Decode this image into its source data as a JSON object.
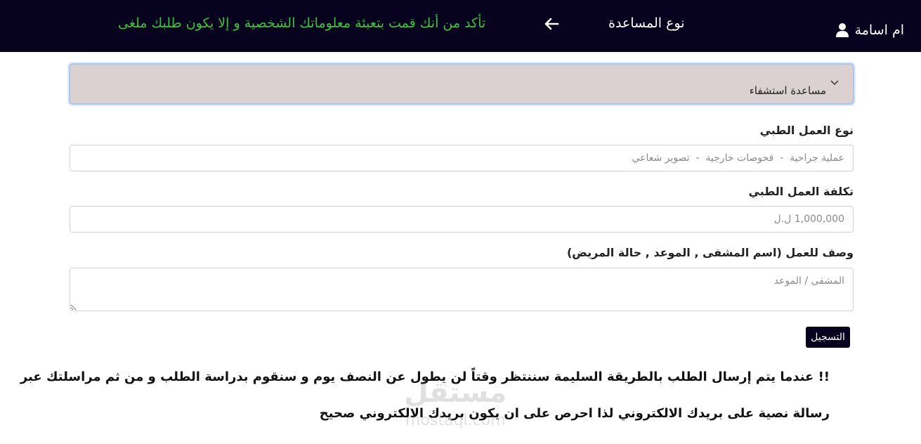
{
  "header": {
    "user_name": "ام اسامة",
    "page_title": "نوع المساعدة",
    "notice": "تأكد من أنك قمت بتعبئة معلوماتك الشخصية و إلا يكون طلبك ملغى"
  },
  "form": {
    "assistance_type": {
      "selected": "مساعدة استشفاء"
    },
    "medical_work_type": {
      "label": "نوع العمل الطبي",
      "placeholder": "عملية جراحية  -  فحوصات خارجية  -  تصوير شعاعي"
    },
    "medical_work_cost": {
      "label": "تكلفة العمل الطبي",
      "placeholder": "1,000,000 ل.ل"
    },
    "work_description": {
      "label": "وصف للعمل (اسم المشفى , الموعد , حالة المريض)",
      "placeholder": "المشفى / الموعد"
    },
    "submit_label": "التسجيل"
  },
  "info": {
    "line1": "!! عندما يتم إرسال الطلب بالطريقة السليمة سننتظر وقتاً لن يطول عن النصف يوم و سنقوم بدراسة الطلب و من ثم مراسلتك عبر",
    "line2": "رسالة نصية على بريدك الالكتروني لذا احرص على ان يكون بريدك الالكتروني صحيح"
  },
  "watermark": {
    "main": "مستقل",
    "sub": "mostaql.com"
  },
  "colors": {
    "header_bg": "#07031f",
    "notice_green": "#34c73a",
    "select_bg": "#dbd1d1",
    "button_bg": "#07031f"
  },
  "icons": [
    "user-icon",
    "arrow-left-icon",
    "chevron-down-icon"
  ]
}
